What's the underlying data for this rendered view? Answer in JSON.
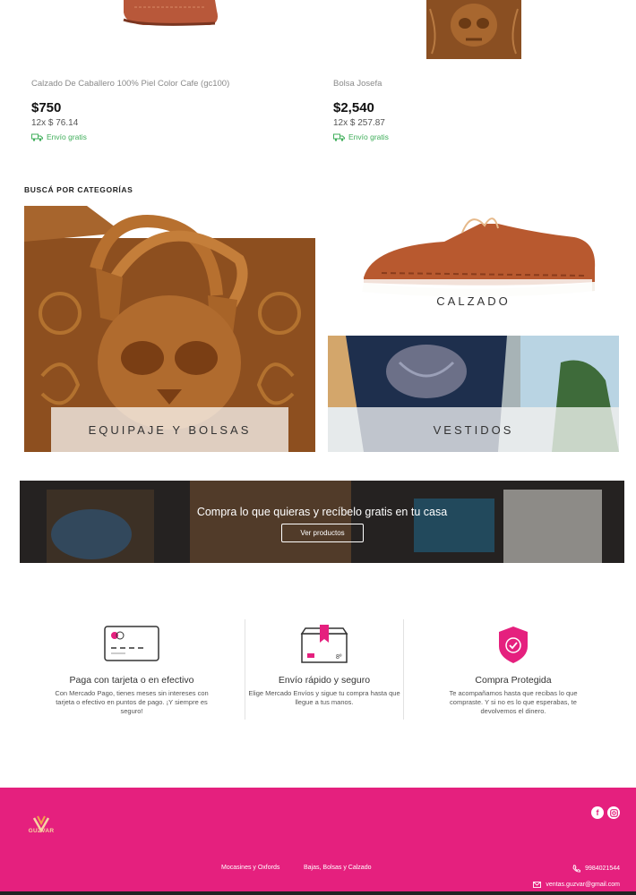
{
  "products": [
    {
      "name": "Calzado De Caballero 100% Piel Color Cafe (gc100)",
      "price": "$750",
      "installments": "12x $ 76.14",
      "shipping": "Envío gratis"
    },
    {
      "name": "Bolsa Josefa",
      "price": "$2,540",
      "installments": "12x $ 257.87",
      "shipping": "Envío gratis"
    }
  ],
  "categories": {
    "heading": "BUSCÁ POR CATEGORÍAS",
    "items": [
      {
        "label": "EQUIPAJE Y BOLSAS"
      },
      {
        "label": "CALZADO"
      },
      {
        "label": "VESTIDOS"
      }
    ]
  },
  "promo": {
    "text": "Compra lo que quieras y recíbelo gratis en tu casa",
    "button_label": "Ver productos"
  },
  "benefits": [
    {
      "icon": "credit-card-icon",
      "title": "Paga con tarjeta o en efectivo",
      "description": "Con Mercado Pago, tienes meses sin intereses con tarjeta o efectivo en puntos de pago. ¡Y siempre es seguro!"
    },
    {
      "icon": "package-icon",
      "title": "Envío rápido y seguro",
      "description": "Elige Mercado Envíos y sigue tu compra hasta que llegue a tus manos."
    },
    {
      "icon": "shield-check-icon",
      "title": "Compra Protegida",
      "description": "Te acompañamos hasta que recibas lo que compraste. Y si no es lo que esperabas, te devolvemos el dinero."
    }
  ],
  "footer": {
    "logo_text": "GUZVAR",
    "links": [
      "Mocasines y Oxfords",
      "Bajas, Bolsas y Calzado"
    ],
    "phone": "9984021544",
    "email": "ventas.guzvar@gmail.com"
  },
  "colors": {
    "brand_pink": "#e5207e",
    "shipping_green": "#3fae5a",
    "leather": "#9a5a2a"
  }
}
